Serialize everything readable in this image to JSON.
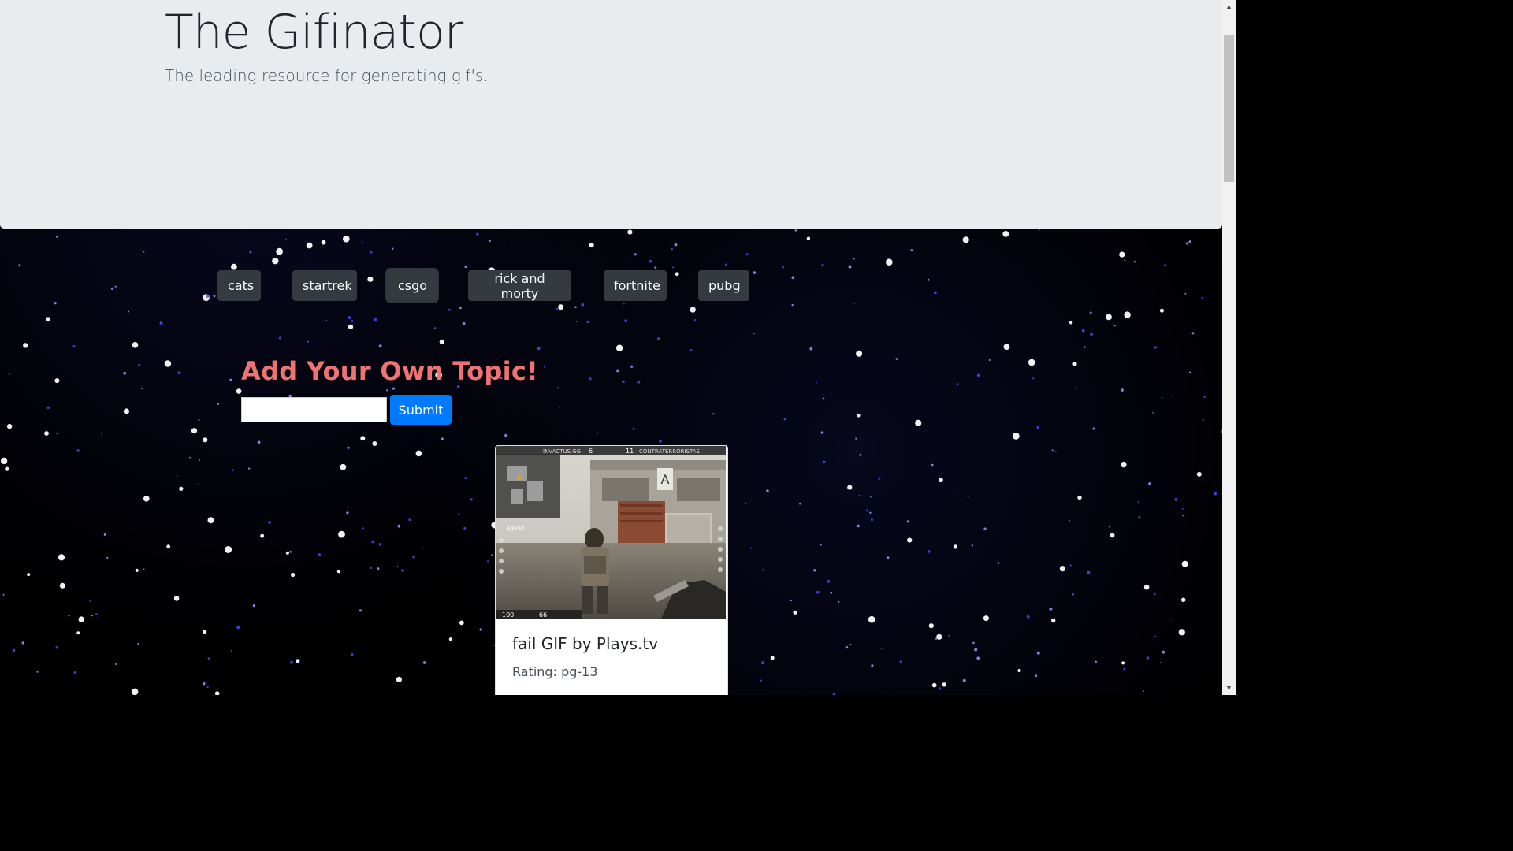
{
  "jumbotron": {
    "title": "The Gifinator",
    "subtitle": "The leading resource for generating gif's."
  },
  "topics": [
    {
      "label": "cats"
    },
    {
      "label": "startrek"
    },
    {
      "label": "csgo"
    },
    {
      "label": "rick and morty"
    },
    {
      "label": "fortnite"
    },
    {
      "label": "pubg"
    }
  ],
  "add_topic": {
    "heading": "Add Your Own Topic!",
    "input_value": "",
    "submit_label": "Submit"
  },
  "gif_card": {
    "title": "fail GIF by Plays.tv",
    "rating": "Rating: pg-13",
    "hud_top_left": "INVACTUS.GG",
    "hud_score_left": "6",
    "hud_score_right": "11",
    "hud_top_right": "CONTRATERRORISTAS",
    "hud_money": "$4650",
    "hud_health": "100",
    "hud_armor": "66"
  },
  "colors": {
    "jumbotron_bg": "#e9ecef",
    "topic_button_bg": "#343a40",
    "heading_color": "#f07373",
    "submit_bg": "#007bff"
  }
}
